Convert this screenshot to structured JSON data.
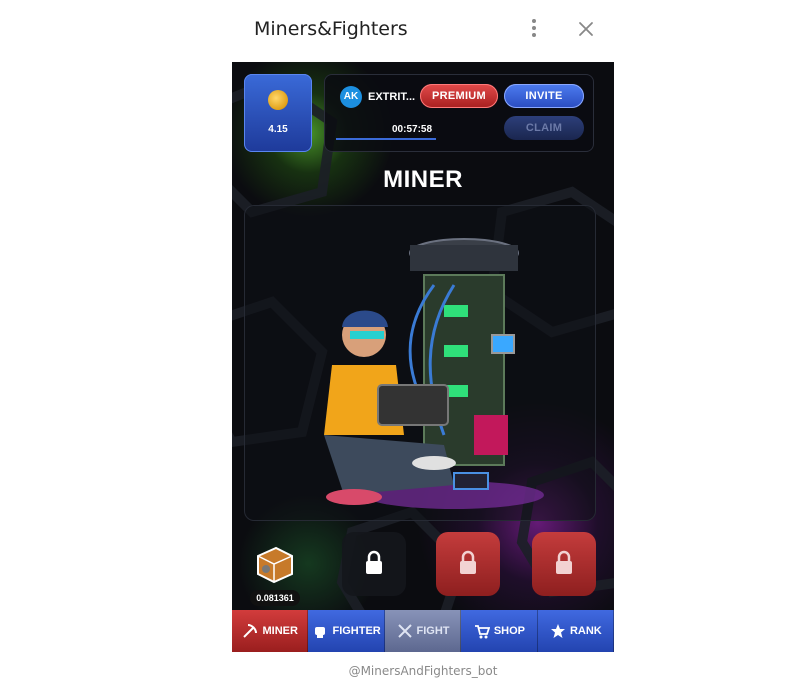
{
  "window": {
    "title": "Miners&Fighters",
    "bot_handle": "@MinersAndFighters_bot"
  },
  "header": {
    "coin_balance": "4.15",
    "user": {
      "initials": "AK",
      "name": "EXTRIT..."
    },
    "premium_label": "PREMIUM",
    "invite_label": "INVITE",
    "claim_label": "CLAIM",
    "timer": "00:57:58"
  },
  "main": {
    "title": "MINER",
    "rig_balance": "0.081361"
  },
  "tabs": [
    {
      "label": "MINER",
      "icon": "pickaxe-icon"
    },
    {
      "label": "FIGHTER",
      "icon": "fist-icon"
    },
    {
      "label": "FIGHT",
      "icon": "crossed-swords-icon"
    },
    {
      "label": "SHOP",
      "icon": "cart-icon"
    },
    {
      "label": "RANK",
      "icon": "star-badge-icon"
    }
  ],
  "colors": {
    "accent_blue": "#3a6ad8",
    "accent_red": "#c43c3c",
    "background": "#0b0c10"
  }
}
